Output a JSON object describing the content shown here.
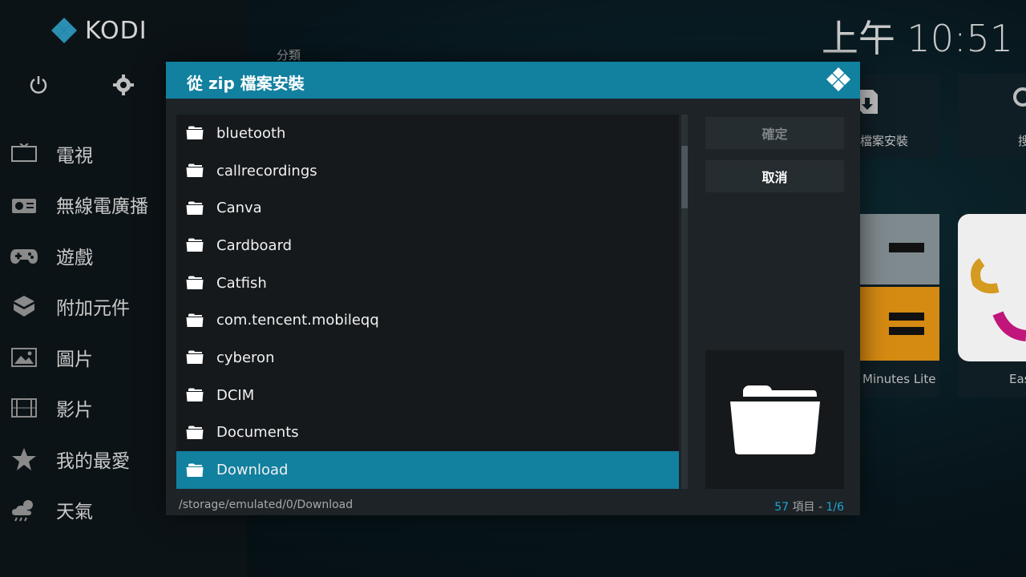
{
  "app": {
    "logo_text": "KODI"
  },
  "clock": "上午 10:51",
  "category_label": "分類",
  "sidebar": {
    "top_icons": [
      "power-icon",
      "gear-icon"
    ],
    "items": [
      {
        "label": "電視",
        "icon": "tv-icon"
      },
      {
        "label": "無線電廣播",
        "icon": "radio-icon"
      },
      {
        "label": "遊戲",
        "icon": "gamepad-icon"
      },
      {
        "label": "附加元件",
        "icon": "addon-box-icon"
      },
      {
        "label": "圖片",
        "icon": "picture-icon"
      },
      {
        "label": "影片",
        "icon": "film-icon"
      },
      {
        "label": "我的最愛",
        "icon": "star-icon"
      },
      {
        "label": "天氣",
        "icon": "weather-icon"
      }
    ]
  },
  "background": {
    "tile1_label": "檔案安裝",
    "tile2_label": "搜",
    "tile3_label": "Minutes Lite",
    "tile4_label": "Easy"
  },
  "dialog": {
    "title": "從 zip 檔案安裝",
    "ok_label": "確定",
    "cancel_label": "取消",
    "items": [
      {
        "label": "bluetooth"
      },
      {
        "label": "callrecordings"
      },
      {
        "label": "Canva"
      },
      {
        "label": "Cardboard"
      },
      {
        "label": "Catfish"
      },
      {
        "label": "com.tencent.mobileqq"
      },
      {
        "label": "cyberon"
      },
      {
        "label": "DCIM"
      },
      {
        "label": "Documents"
      },
      {
        "label": "Download"
      }
    ],
    "selected_index": 9,
    "path": "/storage/emulated/0/Download",
    "count": "57",
    "count_label": "項目 -",
    "page": "1/6",
    "scroll_position": 0.1
  },
  "colors": {
    "accent": "#12809f",
    "accent_text": "#1ea7d3"
  }
}
